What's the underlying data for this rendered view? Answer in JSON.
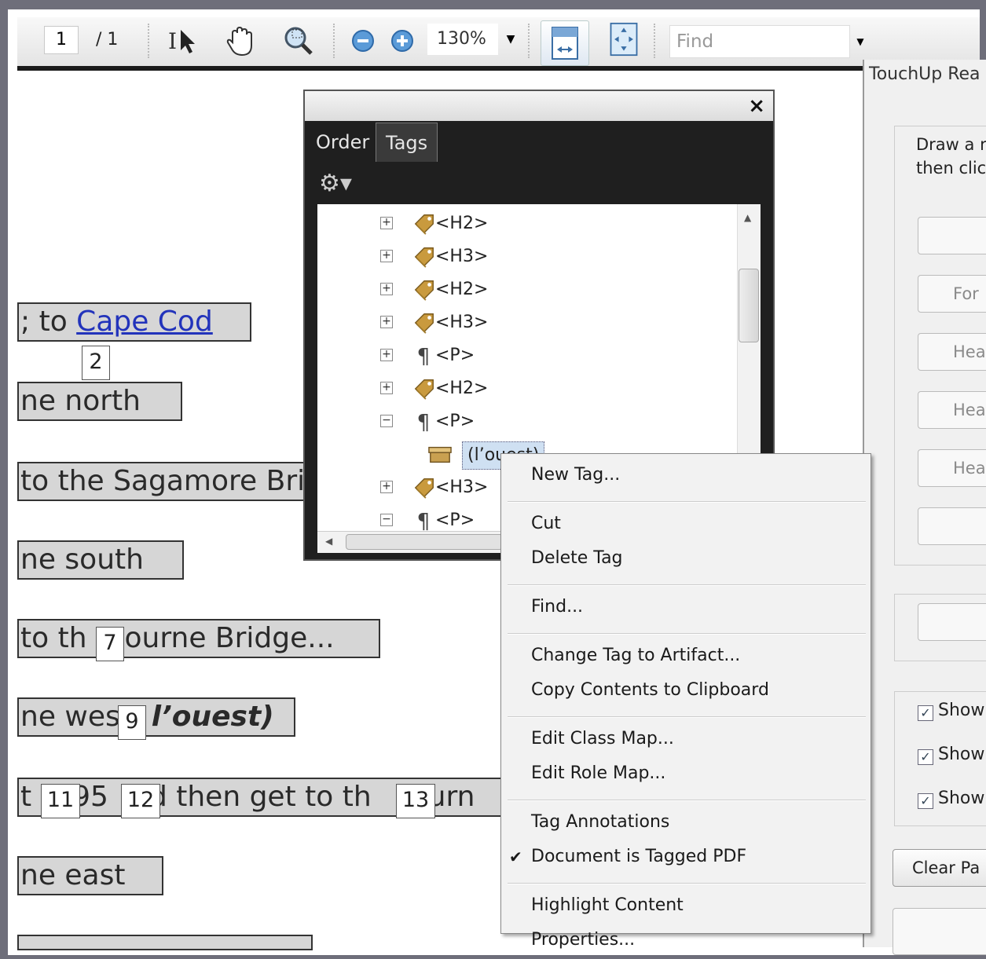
{
  "toolbar": {
    "page_number": "1",
    "page_total": "/ 1",
    "zoom": "130%",
    "find_placeholder": "Find"
  },
  "document": {
    "line1_text": "; to ",
    "line1_link": "Cape Cod",
    "tag_2": "2",
    "line2": "ne north",
    "line3": "to the Sagamore Bri",
    "line4": "ne south",
    "line5a": "to th",
    "line5b": "ourne Bridge...",
    "tag_7": "7",
    "line6a": "ne wes",
    "line6b": "l’ouest)",
    "tag_9": "9",
    "line7a": "t",
    "line7b": "95",
    "line7c": "d then get to th",
    "line7d": "ourn",
    "tag_11": "11",
    "tag_12": "12",
    "tag_13": "13",
    "line8": "ne east"
  },
  "tags_panel": {
    "close": "×",
    "tabs": [
      "Order",
      "Tags"
    ],
    "options_icon": "⚙▾",
    "tree": [
      {
        "label": "<H2>",
        "icon": "tag-icon",
        "expander": "+"
      },
      {
        "label": "<H3>",
        "icon": "tag-icon",
        "expander": "+"
      },
      {
        "label": "<H2>",
        "icon": "tag-icon",
        "expander": "+"
      },
      {
        "label": "<H3>",
        "icon": "tag-icon",
        "expander": "+"
      },
      {
        "label": "<P>",
        "icon": "paragraph-icon",
        "expander": "+"
      },
      {
        "label": "<H2>",
        "icon": "tag-icon",
        "expander": "+"
      },
      {
        "label": "<P>",
        "icon": "paragraph-icon",
        "expander": "−"
      },
      {
        "label": "(l’ouest)",
        "icon": "container-icon",
        "expander": ""
      },
      {
        "label": "<H3>",
        "icon": "tag-icon",
        "expander": "+"
      },
      {
        "label": "<P>",
        "icon": "paragraph-icon",
        "expander": "−"
      }
    ]
  },
  "touchup": {
    "title": "TouchUp Rea",
    "instruction_line1": "Draw a r",
    "instruction_line2": "then clic",
    "buttons": [
      "",
      "For",
      "Hea",
      "Hea",
      "Hea",
      ""
    ],
    "button2": "",
    "checks": [
      "Show",
      "Show",
      "Show"
    ],
    "clear_button": "Clear Pa"
  },
  "context_menu": {
    "items": [
      {
        "label": "New Tag...",
        "group": 0
      },
      {
        "label": "Cut",
        "group": 1
      },
      {
        "label": "Delete Tag",
        "group": 1
      },
      {
        "label": "Find...",
        "group": 2
      },
      {
        "label": "Change Tag to Artifact...",
        "group": 3
      },
      {
        "label": "Copy Contents to Clipboard",
        "group": 3
      },
      {
        "label": "Edit Class Map...",
        "group": 4
      },
      {
        "label": "Edit Role Map...",
        "group": 4
      },
      {
        "label": "Tag Annotations",
        "group": 5
      },
      {
        "label": "Document is Tagged PDF",
        "group": 5,
        "checked": true
      },
      {
        "label": "Highlight Content",
        "group": 6
      },
      {
        "label": "Properties...",
        "group": 6
      }
    ],
    "check_mark": "✔"
  },
  "colors": {
    "link": "#2233bb",
    "tag_highlight": "#cfe0f2",
    "panel_dark": "#1f1f1f"
  }
}
